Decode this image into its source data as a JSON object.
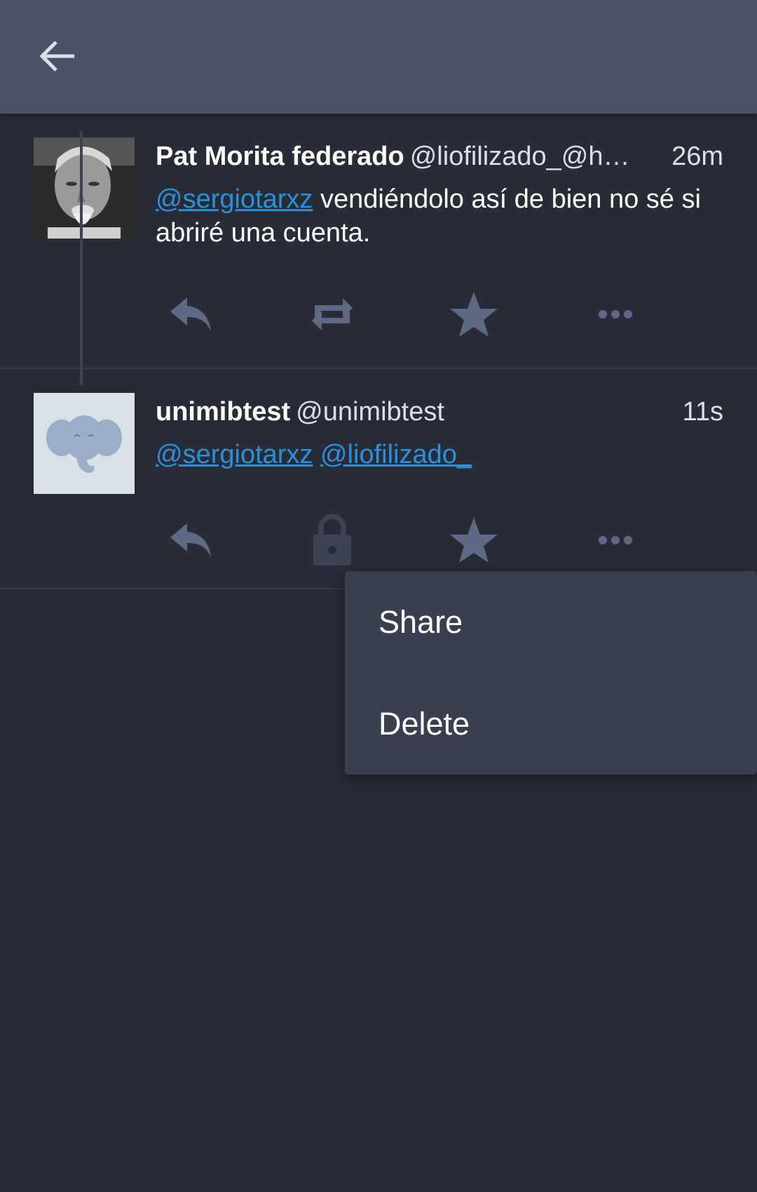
{
  "appbar": {
    "back_icon": "arrow-left-icon"
  },
  "statuses": [
    {
      "display_name": "Pat Morita federado",
      "acct": "@liofilizado_@h…",
      "time": "26m",
      "content_mention": "@sergiotarxz",
      "content_text": " vendiéndolo así de bien no sé si abriré una cuenta.",
      "actions": [
        "reply-icon",
        "boost-icon",
        "favourite-icon",
        "more-icon"
      ]
    },
    {
      "display_name": "unimibtest",
      "acct": "@unimibtest",
      "time": "11s",
      "mentions": [
        "@sergiotarxz",
        "@liofilizado_"
      ],
      "actions": [
        "reply-icon",
        "lock-icon",
        "favourite-icon",
        "more-icon"
      ]
    }
  ],
  "menu": {
    "items": [
      "Share",
      "Delete"
    ]
  },
  "colors": {
    "background": "#282c37",
    "appbar": "#4d5269",
    "mention": "#2b90d9",
    "icon": "#606984",
    "menu": "#393f4f"
  }
}
